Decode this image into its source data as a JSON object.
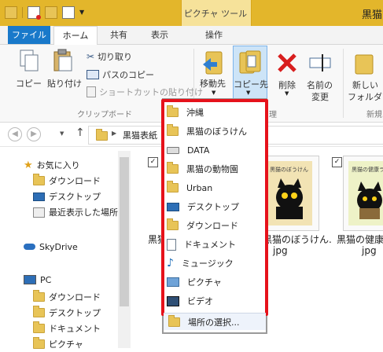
{
  "window": {
    "title": "黒猫",
    "contextual_tab_label": "ピクチャ ツール"
  },
  "tabs": {
    "file": "ファイル",
    "home": "ホーム",
    "share": "共有",
    "view": "表示",
    "manage": "操作"
  },
  "ribbon": {
    "copy": "コピー",
    "paste": "貼り付け",
    "cut": "切り取り",
    "copy_path": "パスのコピー",
    "paste_shortcut": "ショートカットの貼り付け",
    "clipboard_group": "クリップボード",
    "move_to": "移動先",
    "copy_to": "コピー先",
    "delete": "削除",
    "rename_line1": "名前の",
    "rename_line2": "変更",
    "new_folder_line1": "新しい",
    "new_folder_line2": "フォルダー",
    "organize_group_partial": "理",
    "new_group_partial": "新規"
  },
  "address": {
    "path_partial": "黒猫表紙"
  },
  "nav": {
    "favorites": "お気に入り",
    "downloads": "ダウンロード",
    "desktop": "デスクトップ",
    "recent": "最近表示した場所",
    "skydrive": "SkyDrive",
    "pc": "PC",
    "pc_downloads": "ダウンロード",
    "pc_desktop": "デスクトップ",
    "pc_documents": "ドキュメント",
    "pc_pictures": "ピクチャ"
  },
  "files": [
    {
      "name_line1": "黒猫",
      "name_line2": ""
    },
    {
      "name_line1": "黒猫のぼうけん.",
      "name_line2": "jpg",
      "cover_title": "黒猫のぼうけん"
    },
    {
      "name_line1": "黒猫の健康ラ",
      "name_line2": "jpg",
      "cover_title": "黒猫の健康ランド"
    }
  ],
  "copy_to_menu": {
    "items": [
      {
        "label": "沖縄",
        "icon": "folder-icon"
      },
      {
        "label": "黒猫のぼうけん",
        "icon": "folder-icon"
      },
      {
        "label": "DATA",
        "icon": "drive-icon"
      },
      {
        "label": "黒猫の動物園",
        "icon": "folder-icon"
      },
      {
        "label": "Urban",
        "icon": "folder-icon"
      },
      {
        "label": "デスクトップ",
        "icon": "desktop-icon"
      },
      {
        "label": "ダウンロード",
        "icon": "download-folder-icon"
      },
      {
        "label": "ドキュメント",
        "icon": "documents-icon"
      },
      {
        "label": "ミュージック",
        "icon": "music-icon"
      },
      {
        "label": "ピクチャ",
        "icon": "pictures-icon"
      },
      {
        "label": "ビデオ",
        "icon": "video-icon"
      }
    ],
    "choose_location": "場所の選択..."
  },
  "colors": {
    "titlebar": "#e3b62b",
    "file_tab": "#1979ca",
    "highlight": "#e6121b"
  }
}
